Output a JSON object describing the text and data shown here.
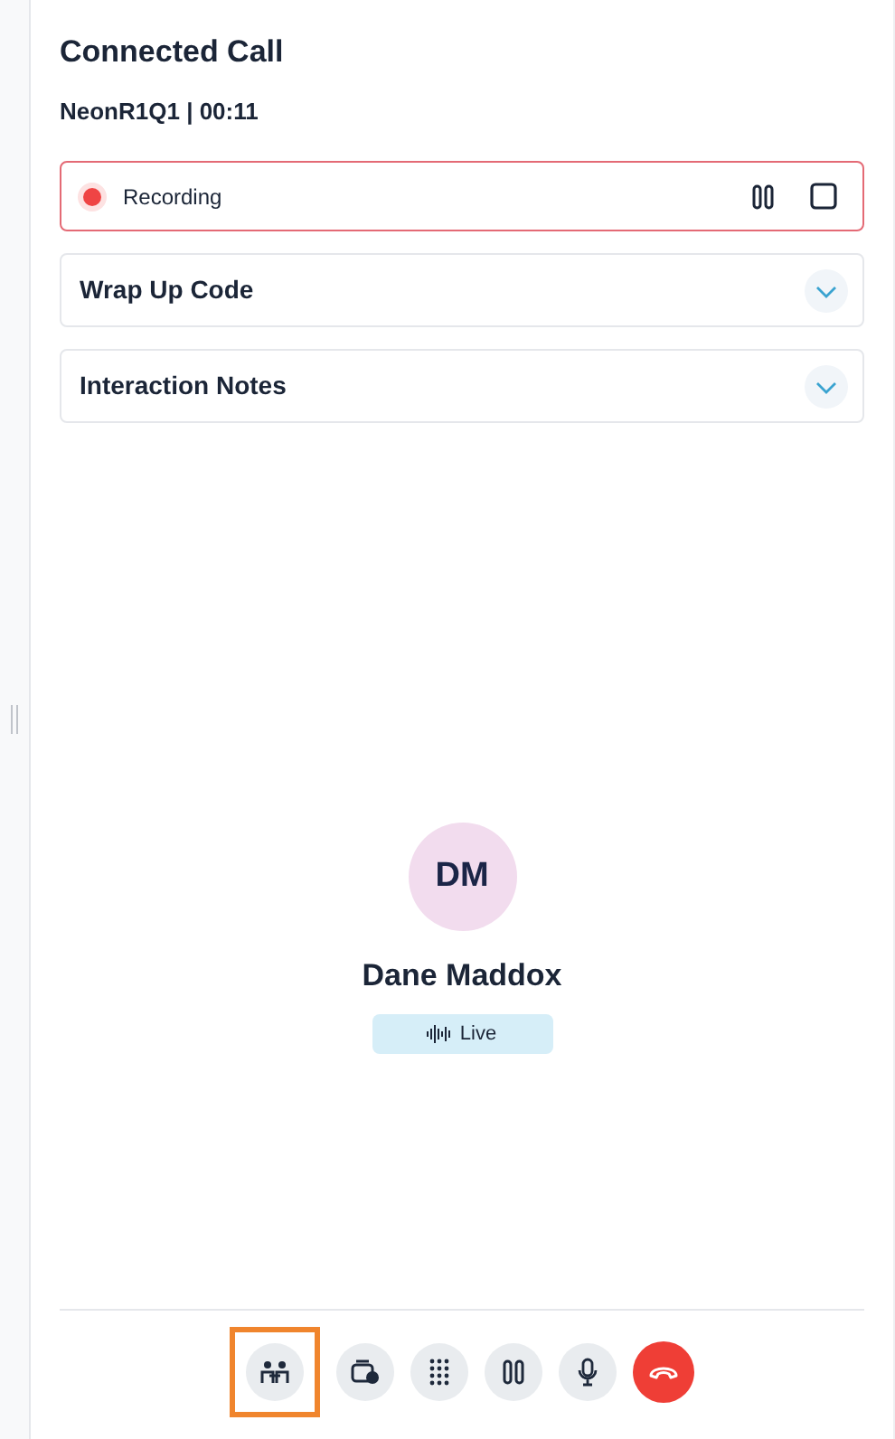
{
  "title": "Connected Call",
  "subtitle": "NeonR1Q1 | 00:11",
  "recording": {
    "label": "Recording",
    "active": true
  },
  "sections": [
    {
      "title": "Wrap Up Code",
      "expanded": false
    },
    {
      "title": "Interaction Notes",
      "expanded": false
    }
  ],
  "contact": {
    "initials": "DM",
    "name": "Dane Maddox",
    "status": "Live"
  },
  "controls": [
    {
      "kind": "consult",
      "highlighted": true
    },
    {
      "kind": "transfer",
      "highlighted": false
    },
    {
      "kind": "dialpad",
      "highlighted": false
    },
    {
      "kind": "hold",
      "highlighted": false
    },
    {
      "kind": "mute",
      "highlighted": false
    },
    {
      "kind": "hangup",
      "highlighted": false
    }
  ]
}
